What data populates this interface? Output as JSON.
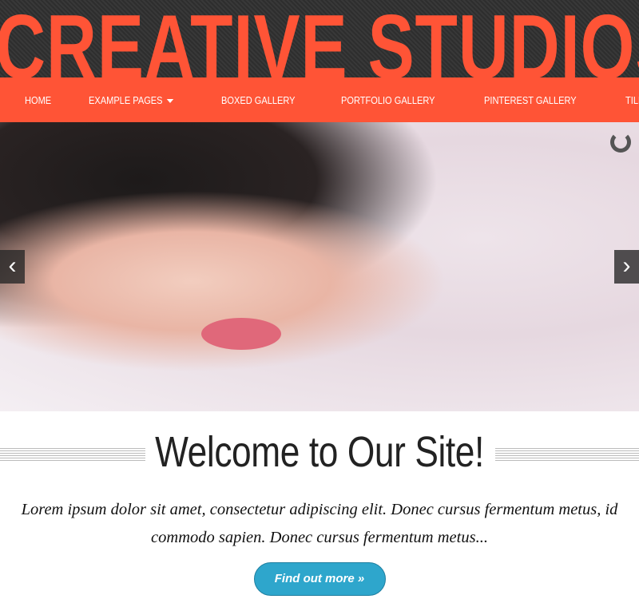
{
  "site": {
    "title": "CREATIVE STUDIOS",
    "accent": "#ff5436"
  },
  "nav": {
    "items": [
      {
        "label": "HOME"
      },
      {
        "label": "EXAMPLE PAGES"
      },
      {
        "label": "BOXED GALLERY"
      },
      {
        "label": "PORTFOLIO GALLERY"
      },
      {
        "label": "PINTEREST GALLERY"
      },
      {
        "label": "TILES"
      }
    ]
  },
  "slider": {
    "prev_icon": "chevron-left",
    "next_icon": "chevron-right",
    "prev": "‹",
    "next": "›"
  },
  "main": {
    "heading": "Welcome to Our Site!",
    "text": "Lorem ipsum dolor sit amet, consectetur adipiscing elit. Donec cursus fermentum metus, id commodo sapien. Donec cursus fermentum metus...",
    "button": "Find out more »",
    "button_color": "#2ea6cc"
  }
}
